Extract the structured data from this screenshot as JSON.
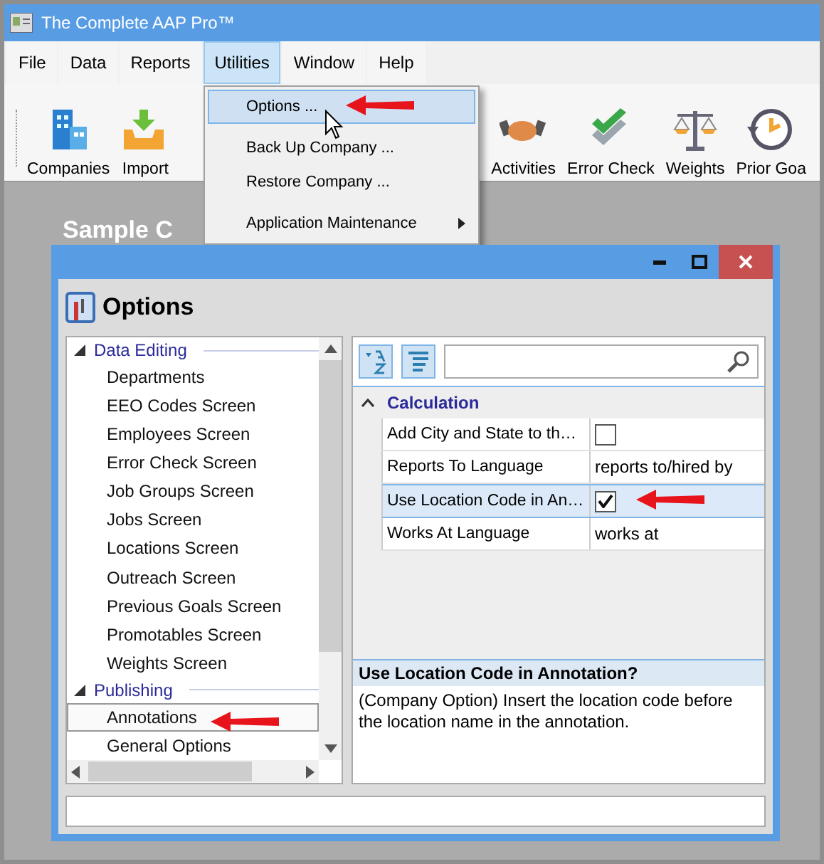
{
  "window": {
    "title": "The Complete AAP Pro™"
  },
  "menu": [
    {
      "label": "File",
      "selected": false
    },
    {
      "label": "Data",
      "selected": false
    },
    {
      "label": "Reports",
      "selected": false
    },
    {
      "label": "Utilities",
      "selected": true
    },
    {
      "label": "Window",
      "selected": false
    },
    {
      "label": "Help",
      "selected": false
    }
  ],
  "dropdown": [
    {
      "label": "Options ...",
      "kind": "item",
      "selected": true
    },
    {
      "label": "Back Up Company ...",
      "kind": "item",
      "selected": false
    },
    {
      "label": "Restore Company ...",
      "kind": "item",
      "selected": false
    },
    {
      "label": "Application Maintenance",
      "kind": "submenu",
      "selected": false
    }
  ],
  "toolbar": [
    {
      "label": "Companies"
    },
    {
      "label": "Import"
    },
    {
      "label": "Activities"
    },
    {
      "label": "Error Check"
    },
    {
      "label": "Weights"
    },
    {
      "label": "Prior Goa"
    }
  ],
  "workspace_title": "Sample C",
  "dialog": {
    "title": "Options",
    "tree": [
      {
        "label": "Data Editing",
        "expanded": true,
        "children": [
          {
            "label": "Departments",
            "selected": false
          },
          {
            "label": "EEO Codes Screen",
            "selected": false
          },
          {
            "label": "Employees Screen",
            "selected": false
          },
          {
            "label": "Error Check Screen",
            "selected": false
          },
          {
            "label": "Job Groups Screen",
            "selected": false
          },
          {
            "label": "Jobs Screen",
            "selected": false
          },
          {
            "label": "Locations Screen",
            "selected": false
          },
          {
            "label": "Outreach Screen",
            "selected": false
          },
          {
            "label": "Previous Goals Screen",
            "selected": false
          },
          {
            "label": "Promotables Screen",
            "selected": false
          },
          {
            "label": "Weights Screen",
            "selected": false
          }
        ]
      },
      {
        "label": "Publishing",
        "expanded": true,
        "children": [
          {
            "label": "Annotations",
            "selected": true
          },
          {
            "label": "General Options",
            "selected": false
          }
        ]
      }
    ],
    "properties": {
      "category": "Calculation",
      "expanded": true,
      "rows": [
        {
          "name": "Add City and State to th…",
          "kind": "checkbox",
          "checked": false,
          "selected": false
        },
        {
          "name": "Reports To Language",
          "kind": "text",
          "value": "reports to/hired by",
          "selected": false
        },
        {
          "name": "Use Location Code in An…",
          "kind": "checkbox",
          "checked": true,
          "selected": true
        },
        {
          "name": "Works At Language",
          "kind": "text",
          "value": "works at",
          "selected": false
        }
      ]
    },
    "description": {
      "title": "Use Location Code in Annotation?",
      "text": "(Company Option)  Insert the location code before the location name in the annotation."
    }
  }
}
